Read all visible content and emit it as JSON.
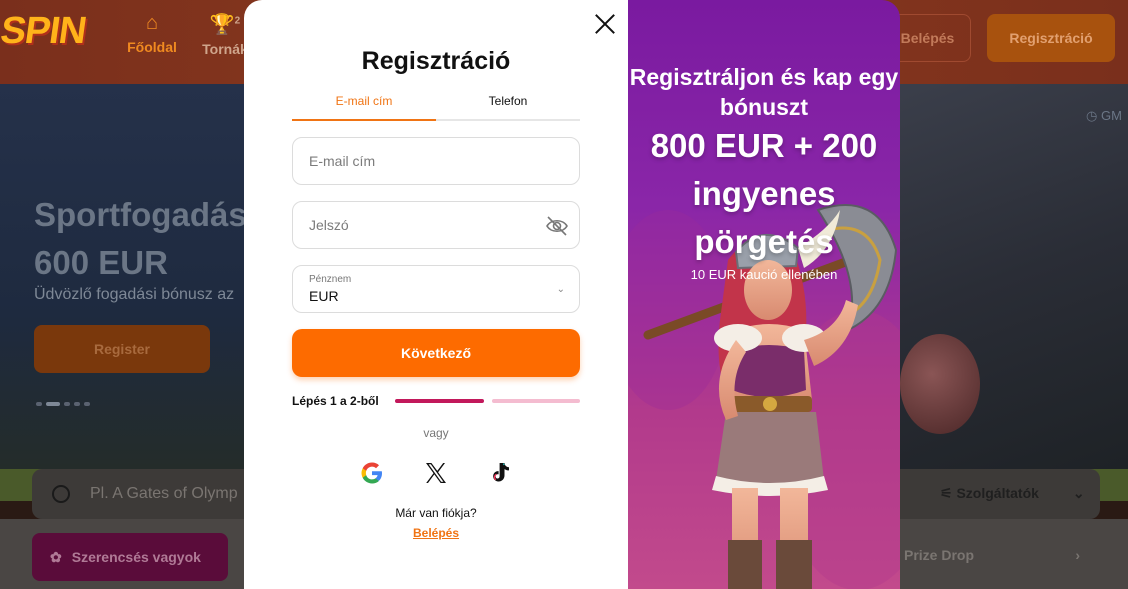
{
  "background": {
    "logo_text": "SPIN",
    "nav": {
      "home_label": "Főoldal",
      "tournaments_label": "Tornák",
      "tournaments_badge": "2"
    },
    "header_buttons": {
      "login_label": "Belépés",
      "register_label": "Regisztráció"
    },
    "hero": {
      "title": "Sportfogadás",
      "amount": "600 EUR",
      "subtitle": "Üdvözlő fogadási bónusz az",
      "button_label": "Register",
      "clock_text": "GM"
    },
    "search": {
      "placeholder": "Pl. A Gates of Olymp",
      "services_label": "Szolgáltatók"
    },
    "lucky_label": "Szerencsés vagyok",
    "prize_drop_label": "Prize Drop"
  },
  "modal": {
    "title": "Regisztráció",
    "tabs": [
      {
        "label": "E-mail cím",
        "active": true
      },
      {
        "label": "Telefon",
        "active": false
      }
    ],
    "email_placeholder": "E-mail cím",
    "password_placeholder": "Jelszó",
    "currency_label": "Pénznem",
    "currency_value": "EUR",
    "next_button": "Következő",
    "step_text": "Lépés 1 a 2-ből",
    "step_progress": 0.5,
    "or_text": "vagy",
    "social": [
      "google-icon",
      "x-icon",
      "tiktok-icon"
    ],
    "have_account": "Már van fiókja?",
    "login_link": "Belépés"
  },
  "promo": {
    "line1": "Regisztráljon és kap egy bónuszt",
    "big_line1": "800 EUR + 200",
    "big_line2": "ingyenes",
    "big_line3": "pörgetés",
    "small": "10 EUR kaució ellenében"
  },
  "colors": {
    "accent": "#fd6b00",
    "tab_active": "#f07414",
    "step_active": "#c2185b",
    "step_inactive": "#f4bcd0",
    "promo_bg": "#8a26a8"
  }
}
